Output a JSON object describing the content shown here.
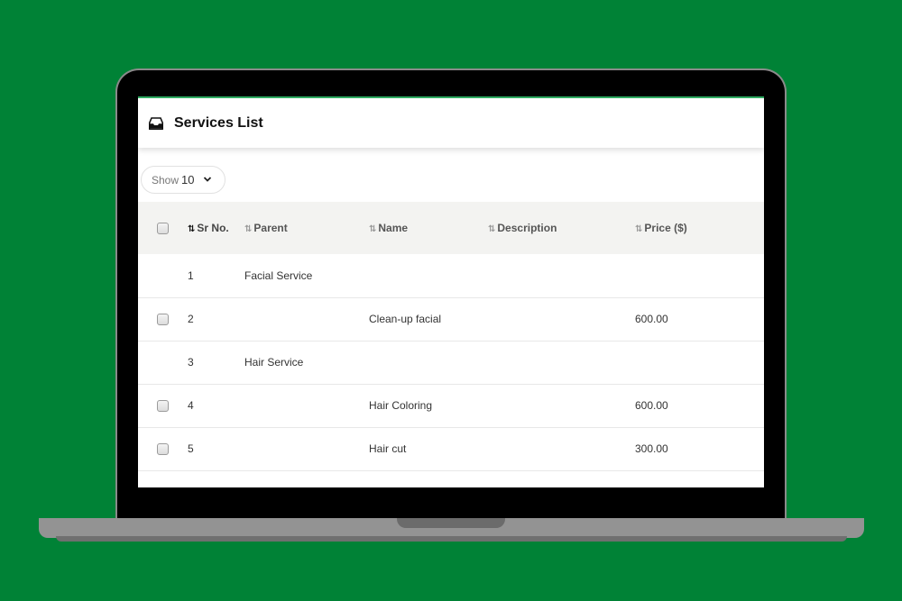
{
  "page": {
    "title": "Services List",
    "header_icon": "inbox-tray-icon"
  },
  "show": {
    "label": "Show",
    "value": "10"
  },
  "table": {
    "columns": [
      {
        "label": "Sr No.",
        "active": true
      },
      {
        "label": "Parent"
      },
      {
        "label": "Name"
      },
      {
        "label": "Description"
      },
      {
        "label": "Price ($)"
      }
    ],
    "rows": [
      {
        "checkbox": false,
        "sr": "1",
        "parent": "Facial Service",
        "name": "",
        "description": "",
        "price": ""
      },
      {
        "checkbox": true,
        "sr": "2",
        "parent": "",
        "name": "Clean-up facial",
        "description": "",
        "price": "600.00"
      },
      {
        "checkbox": false,
        "sr": "3",
        "parent": "Hair Service",
        "name": "",
        "description": "",
        "price": ""
      },
      {
        "checkbox": true,
        "sr": "4",
        "parent": "",
        "name": "Hair Coloring",
        "description": "",
        "price": "600.00"
      },
      {
        "checkbox": true,
        "sr": "5",
        "parent": "",
        "name": "Hair cut",
        "description": "",
        "price": "300.00"
      }
    ]
  },
  "colors": {
    "background": "#008236",
    "accent": "#2eab61",
    "header_row": "#f3f3f1"
  }
}
